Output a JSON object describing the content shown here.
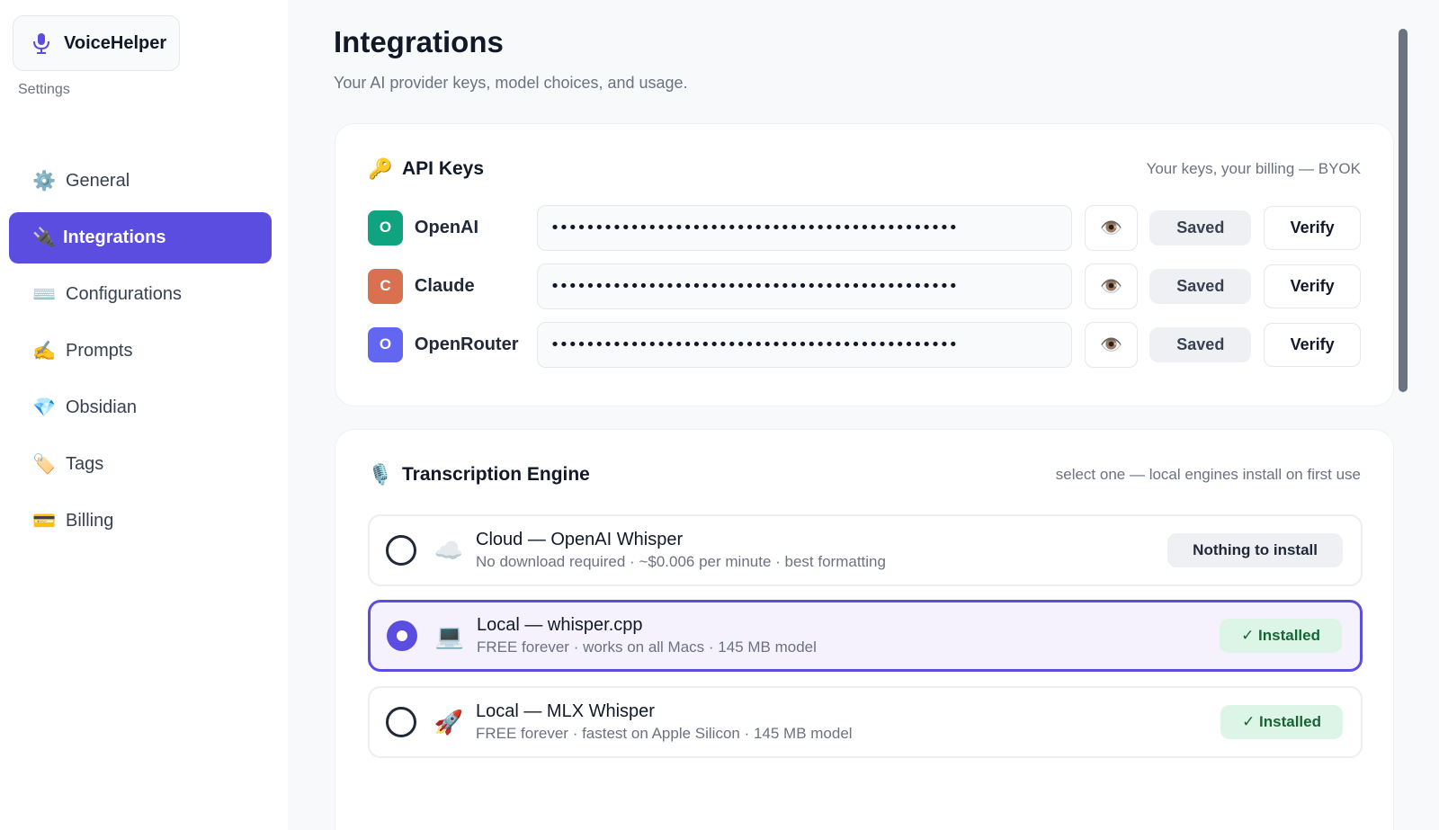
{
  "brand": {
    "name": "VoiceHelper",
    "icon": "microphone-icon",
    "subtitle": "Settings"
  },
  "colors": {
    "accent": "#5b4de0",
    "installed_bg": "#dcf5e7",
    "installed_text": "#166534"
  },
  "nav": [
    {
      "label": "General",
      "icon": "gear-icon",
      "emoji": "⚙️",
      "active": false
    },
    {
      "label": "Integrations",
      "icon": "plug-icon",
      "emoji": "🔌",
      "active": true
    },
    {
      "label": "Configurations",
      "icon": "keyboard-icon",
      "emoji": "⌨️",
      "active": false
    },
    {
      "label": "Prompts",
      "icon": "writing-hand-icon",
      "emoji": "✍️",
      "active": false
    },
    {
      "label": "Obsidian",
      "icon": "gem-icon",
      "emoji": "💎",
      "active": false
    },
    {
      "label": "Tags",
      "icon": "tag-icon",
      "emoji": "🏷️",
      "active": false
    },
    {
      "label": "Billing",
      "icon": "credit-card-icon",
      "emoji": "💳",
      "active": false
    }
  ],
  "page": {
    "title": "Integrations",
    "subtitle": "Your AI provider keys, model choices, and usage."
  },
  "api_keys": {
    "title": "API Keys",
    "icon": "key-icon",
    "hint": "Your keys, your billing — BYOK",
    "providers": [
      {
        "initial": "O",
        "name": "OpenAI",
        "color": "#10a37f",
        "masked_key": "••••••••••••••••••••••••••••••••••••••••••••••",
        "eye_icon": "eye-icon",
        "saved_label": "Saved",
        "verify_label": "Verify"
      },
      {
        "initial": "C",
        "name": "Claude",
        "color": "#d9704f",
        "masked_key": "••••••••••••••••••••••••••••••••••••••••••••••",
        "eye_icon": "eye-icon",
        "saved_label": "Saved",
        "verify_label": "Verify"
      },
      {
        "initial": "O",
        "name": "OpenRouter",
        "color": "#6366f1",
        "masked_key": "••••••••••••••••••••••••••••••••••••••••••••••",
        "eye_icon": "eye-icon",
        "saved_label": "Saved",
        "verify_label": "Verify"
      }
    ]
  },
  "transcription": {
    "title": "Transcription Engine",
    "icon": "microphone-icon",
    "hint": "select one — local engines install on first use",
    "engines": [
      {
        "title": "Cloud — OpenAI Whisper",
        "desc": "No download required · ~$0.006 per minute · best formatting",
        "icon": "cloud-icon",
        "emoji": "☁️",
        "status": "Nothing to install",
        "selected": false,
        "installed": false
      },
      {
        "title": "Local — whisper.cpp",
        "desc": "FREE forever · works on all Macs · 145 MB model",
        "icon": "laptop-icon",
        "emoji": "💻",
        "status": "✓ Installed",
        "selected": true,
        "installed": true
      },
      {
        "title": "Local — MLX Whisper",
        "desc": "FREE forever · fastest on Apple Silicon · 145 MB model",
        "icon": "rocket-icon",
        "emoji": "🚀",
        "status": "✓ Installed",
        "selected": false,
        "installed": true
      }
    ]
  }
}
